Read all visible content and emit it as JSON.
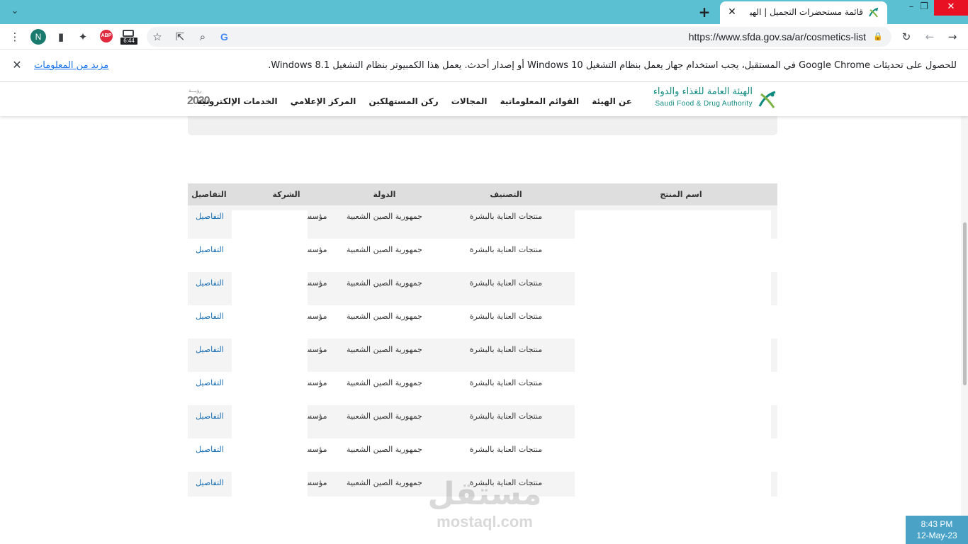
{
  "browser": {
    "tab_title": "قائمة مستحضرات التجميل | الهيئة ال",
    "url": "https://www.sfda.gov.sa/ar/cosmetics-list",
    "profile_initial": "N",
    "abp_label": "ABP",
    "ext_badge": "6:44",
    "google_letter": "G"
  },
  "infobar": {
    "message": "للحصول على تحديثات Google Chrome في المستقبل، يجب استخدام جهاز يعمل بنظام التشغيل Windows 10 أو إصدار أحدث. يعمل هذا الكمبيوتر بنظام التشغيل Windows 8.1.",
    "learn_more": "مزيد من المعلومات"
  },
  "site": {
    "logo_ar": "الهيئة العامة للغذاء والدواء",
    "logo_en": "Saudi Food & Drug Authority",
    "vision_top": "رؤيـــة",
    "vision_year": "2030",
    "nav": [
      "عن الهيئة",
      "القوائم المعلوماتية",
      "المجالات",
      "ركن المستهلكين",
      "المركز الإعلامي",
      "الخدمات الإلكترونية"
    ]
  },
  "table": {
    "headers": {
      "product": "اسم المنتج",
      "category": "التصنيف",
      "country": "الدولة",
      "company": "الشركة",
      "details": "التفاصيل"
    },
    "rows": [
      {
        "category": "منتجات العناية بالبشرة",
        "country": "جمهورية الصين الشعبية",
        "company": "مؤسسة",
        "details": "التفاصيل"
      },
      {
        "category": "منتجات العناية بالبشرة",
        "country": "جمهورية الصين الشعبية",
        "company": "مؤسسة",
        "details": "التفاصيل"
      },
      {
        "category": "منتجات العناية بالبشرة",
        "country": "جمهورية الصين الشعبية",
        "company": "مؤسسة",
        "details": "التفاصيل"
      },
      {
        "category": "منتجات العناية بالبشرة",
        "country": "جمهورية الصين الشعبية",
        "company": "مؤسسة",
        "details": "التفاصيل"
      },
      {
        "category": "منتجات العناية بالبشرة",
        "country": "جمهورية الصين الشعبية",
        "company": "مؤسسة",
        "details": "التفاصيل"
      },
      {
        "category": "منتجات العناية بالبشرة",
        "country": "جمهورية الصين الشعبية",
        "company": "مؤسسة",
        "details": "التفاصيل"
      },
      {
        "category": "منتجات العناية بالبشرة",
        "country": "جمهورية الصين الشعبية",
        "company": "مؤسسة",
        "details": "التفاصيل"
      },
      {
        "category": "منتجات العناية بالبشرة",
        "country": "جمهورية الصين الشعبية",
        "company": "مؤسسة",
        "details": "التفاصيل"
      },
      {
        "category": "منتجات العناية بالبشرة",
        "country": "جمهورية الصين الشعبية",
        "company": "مؤسسة",
        "details": "التفاصيل"
      }
    ]
  },
  "watermark": {
    "ar": "مستقل",
    "en": "mostaql.com"
  },
  "clock": {
    "time": "8:43 PM",
    "date": "12-May-23"
  },
  "colors": {
    "tab_strip": "#5bc0d2",
    "brand_green": "#0e8a7f",
    "link_blue": "#1a6fb3",
    "clock_bg": "#4aa3c6"
  }
}
